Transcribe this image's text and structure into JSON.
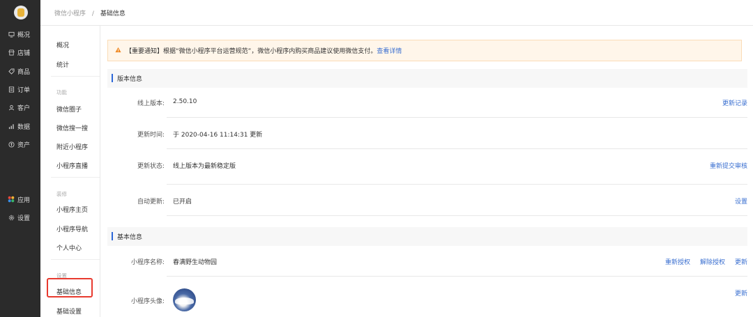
{
  "nav": {
    "items": [
      {
        "label": "概况",
        "icon": "monitor-icon"
      },
      {
        "label": "店铺",
        "icon": "store-icon"
      },
      {
        "label": "商品",
        "icon": "tag-icon"
      },
      {
        "label": "订单",
        "icon": "order-icon"
      },
      {
        "label": "客户",
        "icon": "user-icon"
      },
      {
        "label": "数据",
        "icon": "chart-icon"
      },
      {
        "label": "资产",
        "icon": "asset-icon"
      },
      {
        "label": "应用",
        "icon": "apps-icon"
      },
      {
        "label": "设置",
        "icon": "gear-icon"
      }
    ]
  },
  "breadcrumb": {
    "parent": "微信小程序",
    "separator": "/",
    "current": "基础信息"
  },
  "subnav": {
    "top_items": [
      "概况",
      "统计"
    ],
    "group_function": "功能",
    "function_items": [
      "微信圈子",
      "微信搜一搜",
      "附近小程序",
      "小程序直播"
    ],
    "group_decor": "装修",
    "decor_items": [
      "小程序主页",
      "小程序导航",
      "个人中心"
    ],
    "group_settings": "设置",
    "settings_items": [
      "基础信息",
      "基础设置"
    ]
  },
  "notice": {
    "icon": "warning-icon",
    "text": "【重要通知】根据“微信小程序平台运营规范”，微信小程序内购买商品建议使用微信支付。",
    "link": "查看详情"
  },
  "version": {
    "section_title": "版本信息",
    "online_label": "线上版本:",
    "online_value": "2.50.10",
    "online_action": "更新记录",
    "time_label": "更新时间:",
    "time_value": "于 2020-04-16 11:14:31 更新",
    "status_label": "更新状态:",
    "status_value": "线上版本为最新稳定版",
    "status_action": "重新提交审核",
    "auto_label": "自动更新:",
    "auto_value": "已开启",
    "auto_action": "设置"
  },
  "basic": {
    "section_title": "基本信息",
    "name_label": "小程序名称:",
    "name_value": "春满野生动物园",
    "name_actions": [
      "重新授权",
      "解除授权",
      "更新"
    ],
    "avatar_label": "小程序头像:",
    "avatar_action": "更新"
  },
  "colors": {
    "accent": "#3a6fd0",
    "highlight_box": "#e83a2f",
    "nav_bg": "#2b2b2b",
    "section_bar": "#2b67d8"
  }
}
